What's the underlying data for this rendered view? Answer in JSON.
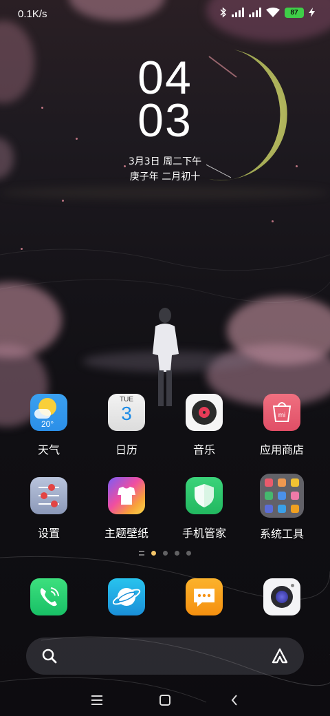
{
  "status_bar": {
    "net_speed": "0.1K/s",
    "battery_level": "87",
    "icons": [
      "bluetooth-icon",
      "signal-icon",
      "signal-icon",
      "wifi-icon",
      "battery-icon",
      "charging-icon"
    ]
  },
  "clock": {
    "hour": "04",
    "minute": "03",
    "date": "3月3日 周二下午",
    "lunar_date": "庚子年 二月初十"
  },
  "apps": [
    {
      "label": "天气",
      "icon": "weather-icon",
      "temp": "20°"
    },
    {
      "label": "日历",
      "icon": "calendar-icon",
      "weekday": "TUE",
      "day": "3"
    },
    {
      "label": "音乐",
      "icon": "music-icon"
    },
    {
      "label": "应用商店",
      "icon": "app-store-icon",
      "badge": "mi"
    },
    {
      "label": "设置",
      "icon": "settings-icon"
    },
    {
      "label": "主题壁纸",
      "icon": "themes-icon"
    },
    {
      "label": "手机管家",
      "icon": "security-icon"
    },
    {
      "label": "系统工具",
      "icon": "system-tools-folder-icon"
    }
  ],
  "page_indicator": {
    "pages": 3,
    "active": 0
  },
  "dock": [
    {
      "name": "phone",
      "icon": "phone-icon"
    },
    {
      "name": "browser",
      "icon": "browser-icon"
    },
    {
      "name": "messages",
      "icon": "messages-icon"
    },
    {
      "name": "camera",
      "icon": "camera-icon"
    }
  ],
  "search_bar": {
    "icons": [
      "search-icon",
      "assistant-icon"
    ]
  },
  "nav_bar": {
    "icons": [
      "menu-icon",
      "home-icon",
      "back-icon"
    ]
  },
  "colors": {
    "battery": "#3fce48",
    "page_dot_active": "#f5c66a"
  }
}
